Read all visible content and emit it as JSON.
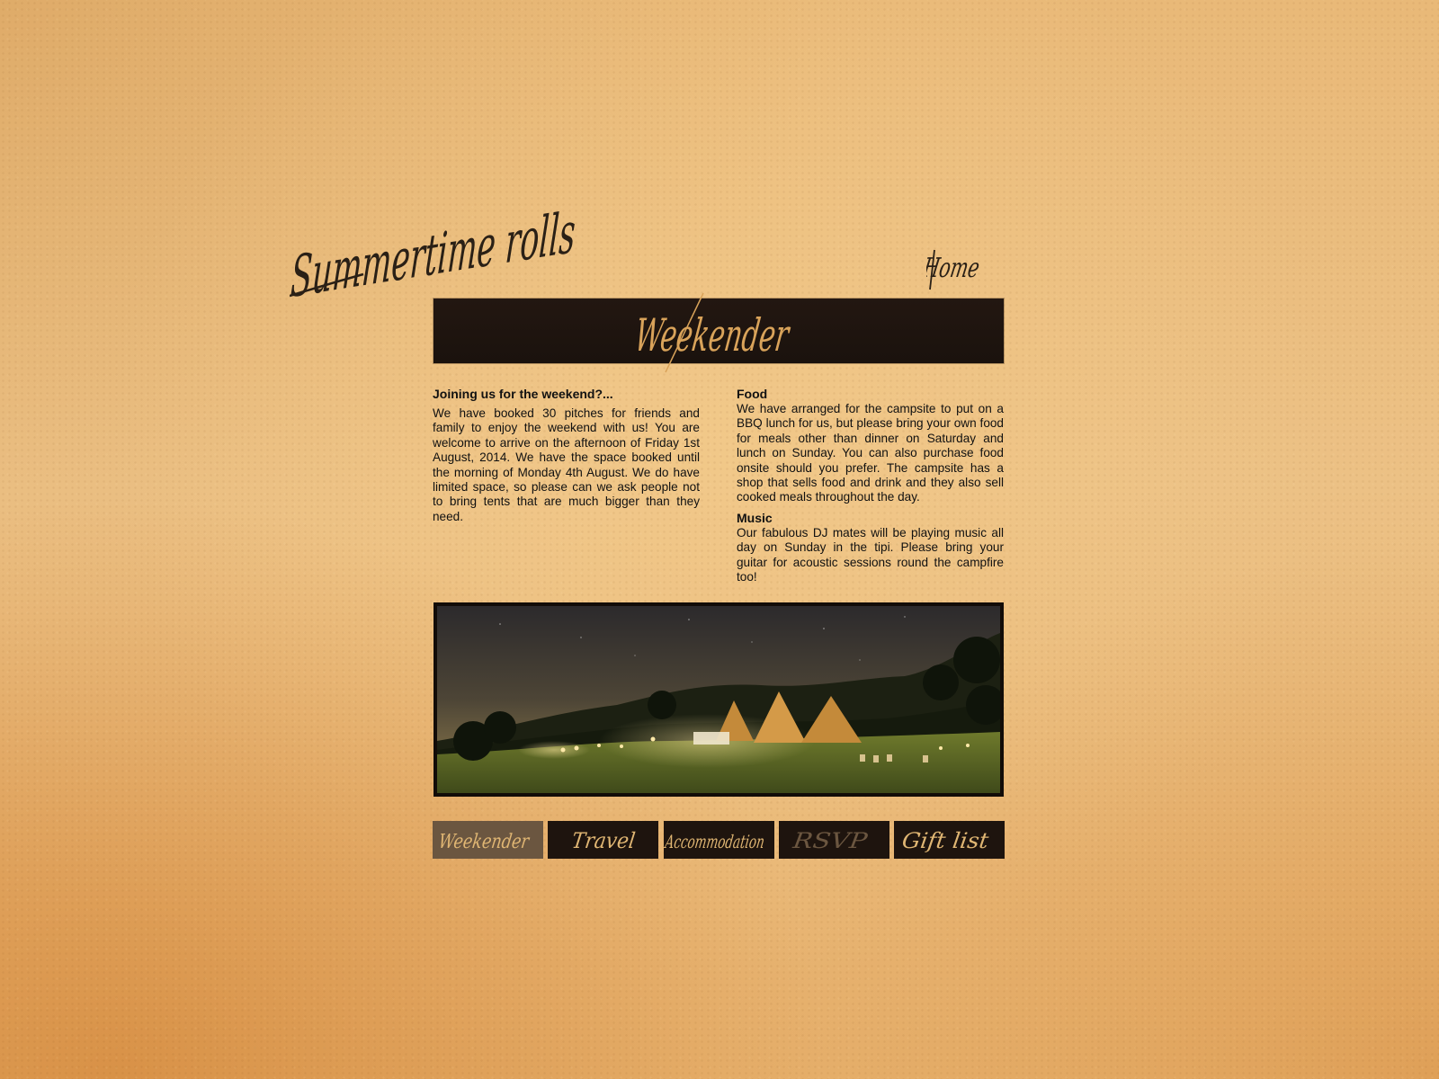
{
  "site": {
    "title": "Summertime rolls",
    "home_label": "Home"
  },
  "page": {
    "banner_title": "Weekender"
  },
  "content": {
    "left": {
      "heading": "Joining us for the weekend?...",
      "body": "We have booked 30 pitches for friends and family to enjoy the weekend with us! You are welcome to arrive on the afternoon of Friday 1st August, 2014. We have the space booked until the morning of Monday 4th August. We do have limited space, so please can we ask people not to bring tents that are much bigger than they need."
    },
    "right": {
      "food_heading": "Food",
      "food_body": "We have arranged for the campsite to put on a BBQ lunch for us, but please bring your own food for meals other than dinner on Saturday and lunch on Sunday. You can also purchase food onsite should you prefer. The campsite has a shop that sells food and drink and they also sell cooked meals throughout the day.",
      "music_heading": "Music",
      "music_body": "Our fabulous DJ mates will be playing music all day on Sunday in the tipi. Please bring your guitar for acoustic sessions round the campfire too!"
    }
  },
  "photo": {
    "subject": "tipi-campsite-at-night"
  },
  "nav": {
    "items": [
      {
        "label": "Weekender",
        "active": true
      },
      {
        "label": "Travel",
        "active": false
      },
      {
        "label": "Accommodation",
        "active": false
      },
      {
        "label": "RSVP",
        "active": false
      },
      {
        "label": "Gift list",
        "active": false
      }
    ]
  },
  "colors": {
    "paper": "#ecc185",
    "dark_panel": "#1e140e",
    "active_tab": "#6b5640",
    "gold_script": "#d9a35a",
    "text": "#111111"
  }
}
